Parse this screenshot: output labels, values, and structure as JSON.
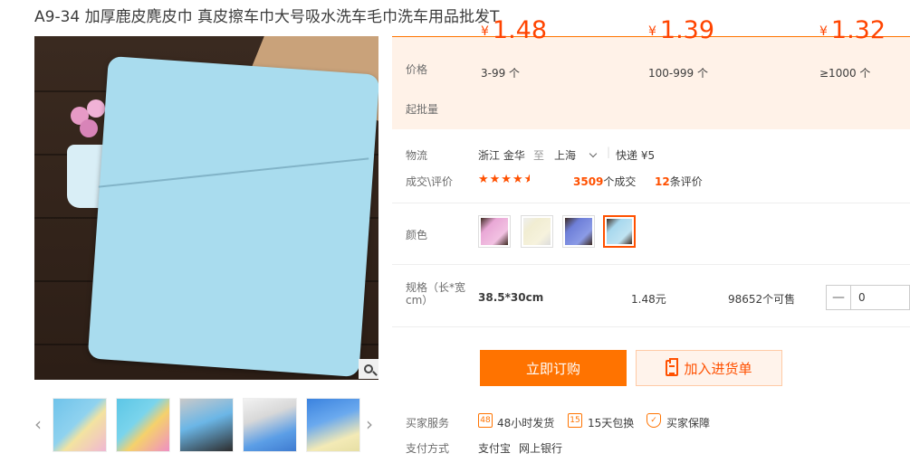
{
  "product": {
    "title": "A9-34 加厚鹿皮麂皮巾 真皮擦车巾大号吸水洗车毛巾洗车用品批发T"
  },
  "price_panel": {
    "price_label": "价格",
    "batch_label": "起批量",
    "currency": "¥",
    "tiers": [
      {
        "price": "1.48",
        "qty": "3-99 个"
      },
      {
        "price": "1.39",
        "qty": "100-999 个"
      },
      {
        "price": "1.32",
        "qty": "≥1000 个"
      }
    ]
  },
  "logistics": {
    "label": "物流",
    "from": "浙江 金华",
    "to_word": "至",
    "to": "上海",
    "shipping": "快递 ¥5"
  },
  "deals": {
    "label": "成交\\评价",
    "rating_stars": 4.5,
    "sales_count": "3509",
    "sales_suffix": "个成交",
    "review_count": "12",
    "review_suffix": "条评价"
  },
  "color": {
    "label": "颜色",
    "options": [
      {
        "name": "pink",
        "color": "#e9a8d6"
      },
      {
        "name": "cream",
        "color": "#f1edd2"
      },
      {
        "name": "blue",
        "color": "#6e7fd8"
      },
      {
        "name": "light-blue",
        "color": "#a8d8ee"
      }
    ],
    "selected_index": 3
  },
  "spec": {
    "label": "规格（长*宽cm）",
    "size": "38.5*30cm",
    "price": "1.48元",
    "stock": "98652个可售",
    "quantity": "0"
  },
  "actions": {
    "buy_label": "立即订购",
    "cart_label": "加入进货单"
  },
  "services": {
    "label": "买家服务",
    "items": [
      {
        "icon": "48-hour-icon",
        "text": "48小时发货"
      },
      {
        "icon": "15-day-icon",
        "text": "15天包换"
      },
      {
        "icon": "shield-icon",
        "text": "买家保障"
      }
    ]
  },
  "payment": {
    "label": "支付方式",
    "methods": [
      "支付宝",
      "网上银行"
    ]
  },
  "colors": {
    "accent": "#ff5000",
    "button": "#ff7300",
    "panel_bg": "#fff2e8"
  }
}
